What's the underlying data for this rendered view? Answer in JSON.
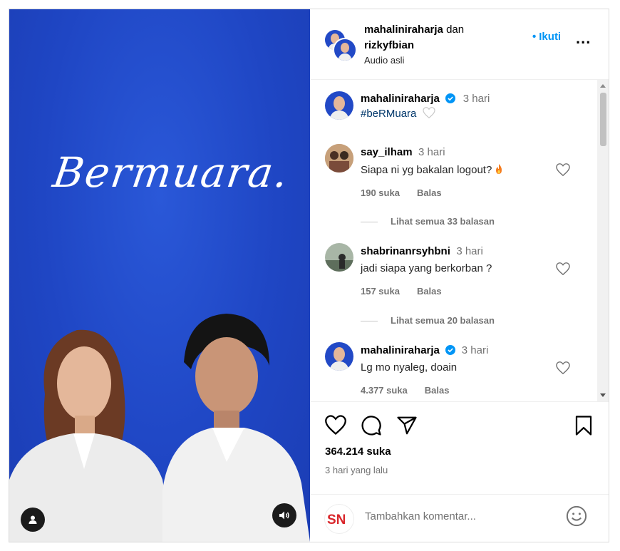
{
  "post": {
    "logo_text": "Bermuara",
    "header": {
      "user1": "mahaliniraharja",
      "conj": "dan",
      "user2": "rizkyfbian",
      "audio": "Audio asli",
      "follow": "Ikuti",
      "more": "..."
    },
    "caption": {
      "user": "mahaliniraharja",
      "time": "3 hari",
      "text": "#beRMuara"
    },
    "comments": [
      {
        "user": "say_ilham",
        "time": "3 hari",
        "text": "Siapa ni yg bakalan logout?",
        "likes": "190 suka",
        "reply": "Balas",
        "view_replies": "Lihat semua 33 balasan"
      },
      {
        "user": "shabrinanrsyhbni",
        "time": "3 hari",
        "text": "jadi siapa yang berkorban ?",
        "likes": "157 suka",
        "reply": "Balas",
        "view_replies": "Lihat semua 20 balasan"
      },
      {
        "user": "mahaliniraharja",
        "time": "3 hari",
        "text": "Lg mo nyaleg, doain",
        "likes": "4.377 suka",
        "reply": "Balas"
      }
    ],
    "likes_total": "364.214 suka",
    "date": "3 hari yang lalu",
    "add_comment": {
      "placeholder": "Tambahkan komentar...",
      "avatar_text": "SN"
    }
  },
  "colors": {
    "accent": "#0095f6",
    "media_bg": "#2049c9"
  }
}
